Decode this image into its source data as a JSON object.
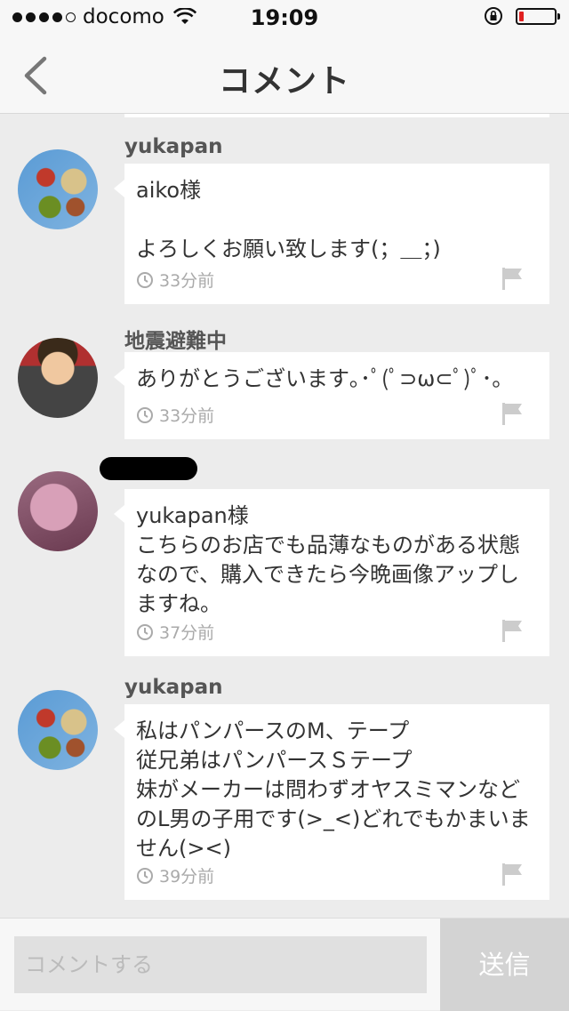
{
  "status_bar": {
    "signal_bars_filled": 4,
    "signal_bars_total": 5,
    "carrier": "docomo",
    "time": "19:09",
    "battery_color": "#e02020",
    "battery_level": 0.12
  },
  "nav": {
    "title": "コメント",
    "back_icon": "chevron-left-icon"
  },
  "comments": [
    {
      "username": "yukapan",
      "avatar": "bento-photo",
      "text": "aiko様\n\nよろしくお願い致します(；＿；)",
      "time": "33分前"
    },
    {
      "username": "地震避難中",
      "avatar": "child-photo",
      "text": "ありがとうございます｡･ﾟ(ﾟ⊃ω⊂ﾟ)ﾟ･｡",
      "time": "33分前"
    },
    {
      "username": "",
      "avatar": "pink-character-photo",
      "text": "yukapan様\nこちらのお店でも品薄なものがある状態なので、購入できたら今晩画像アップしますね。",
      "time": "37分前"
    },
    {
      "username": "yukapan",
      "avatar": "bento-photo",
      "text": "私はパンパースのM、テープ\n従兄弟はパンパースＳテープ\n妹がメーカーは問わずオヤスミマンなどのL男の子用です(>_<)どれでもかまいません(><)",
      "time": "39分前"
    }
  ],
  "composer": {
    "placeholder": "コメントする",
    "value": "",
    "send_label": "送信"
  },
  "colors": {
    "background": "#ececec",
    "bar": "#f7f7f7",
    "bubble": "#ffffff",
    "meta_text": "#aaaaaa",
    "send_disabled": "#d3d3d3"
  }
}
